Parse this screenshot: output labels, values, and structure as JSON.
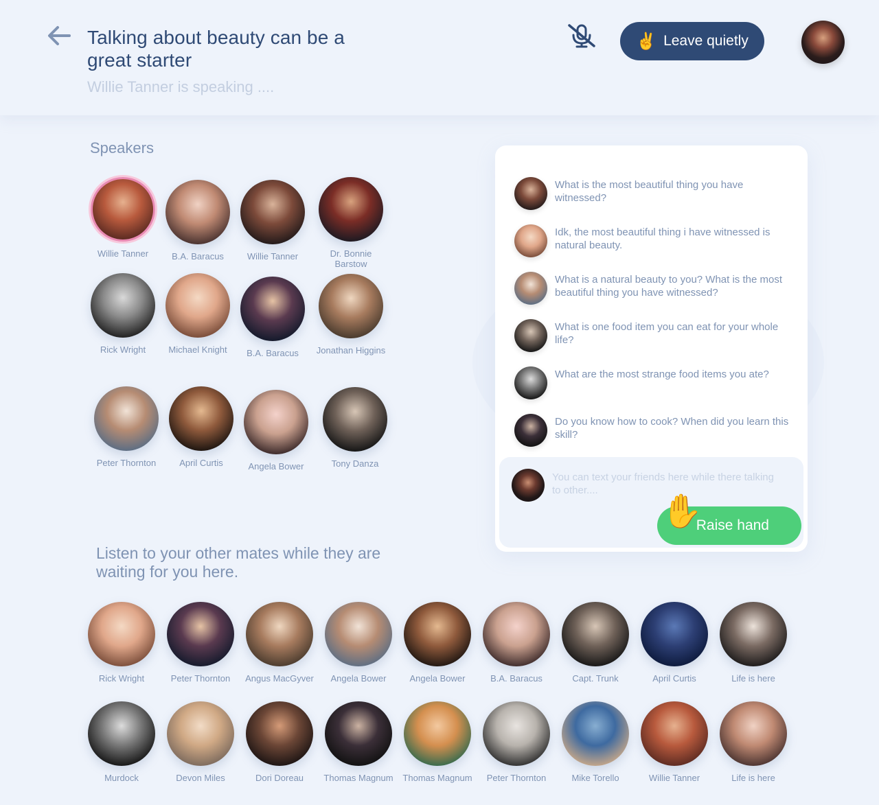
{
  "header": {
    "title": "Talking about beauty can be a great starter",
    "speaking": "Willie Tanner is speaking ....",
    "leave_emoji": "✌️",
    "leave_label": "Leave quietly"
  },
  "speakers_label": "Speakers",
  "speakers": [
    {
      "name": "Willie Tanner",
      "active": true
    },
    {
      "name": "B.A. Baracus"
    },
    {
      "name": "Willie Tanner"
    },
    {
      "name": "Dr. Bonnie Barstow"
    },
    {
      "name": "Rick Wright"
    },
    {
      "name": "Michael Knight"
    },
    {
      "name": "B.A. Baracus"
    },
    {
      "name": "Jonathan Higgins"
    },
    {
      "name": "Peter Thornton"
    },
    {
      "name": "April Curtis"
    },
    {
      "name": "Angela Bower"
    },
    {
      "name": "Tony Danza"
    }
  ],
  "listen_label": "Listen to your other mates while they are waiting for you here.",
  "listeners": [
    {
      "name": "Rick Wright"
    },
    {
      "name": "Peter Thornton"
    },
    {
      "name": "Angus MacGyver"
    },
    {
      "name": "Angela Bower"
    },
    {
      "name": "Angela Bower"
    },
    {
      "name": "B.A. Baracus"
    },
    {
      "name": "Capt. Trunk"
    },
    {
      "name": "April Curtis"
    },
    {
      "name": "Life is here"
    },
    {
      "name": "Murdock"
    },
    {
      "name": "Devon Miles"
    },
    {
      "name": "Dori Doreau"
    },
    {
      "name": "Thomas Magnum"
    },
    {
      "name": "Thomas Magnum"
    },
    {
      "name": "Peter Thornton"
    },
    {
      "name": "Mike Torello"
    },
    {
      "name": "Willie Tanner"
    },
    {
      "name": "Life is here"
    }
  ],
  "chat": {
    "messages": [
      {
        "text": "What is the most beautiful thing you have witnessed?"
      },
      {
        "text": "Idk, the most beautiful thing i have witnessed is natural beauty."
      },
      {
        "text": "What is a natural beauty to you? What is the most beautiful thing you have witnessed?"
      },
      {
        "text": "What is one food item you can eat for your whole life?"
      },
      {
        "text": "What are the most strange food items you ate?"
      },
      {
        "text": "Do you know how to cook? When did you learn this skill?"
      }
    ],
    "placeholder": "You can text your friends here while there talking to other....",
    "raise_emoji": "✋",
    "raise_label": "Raise hand"
  }
}
